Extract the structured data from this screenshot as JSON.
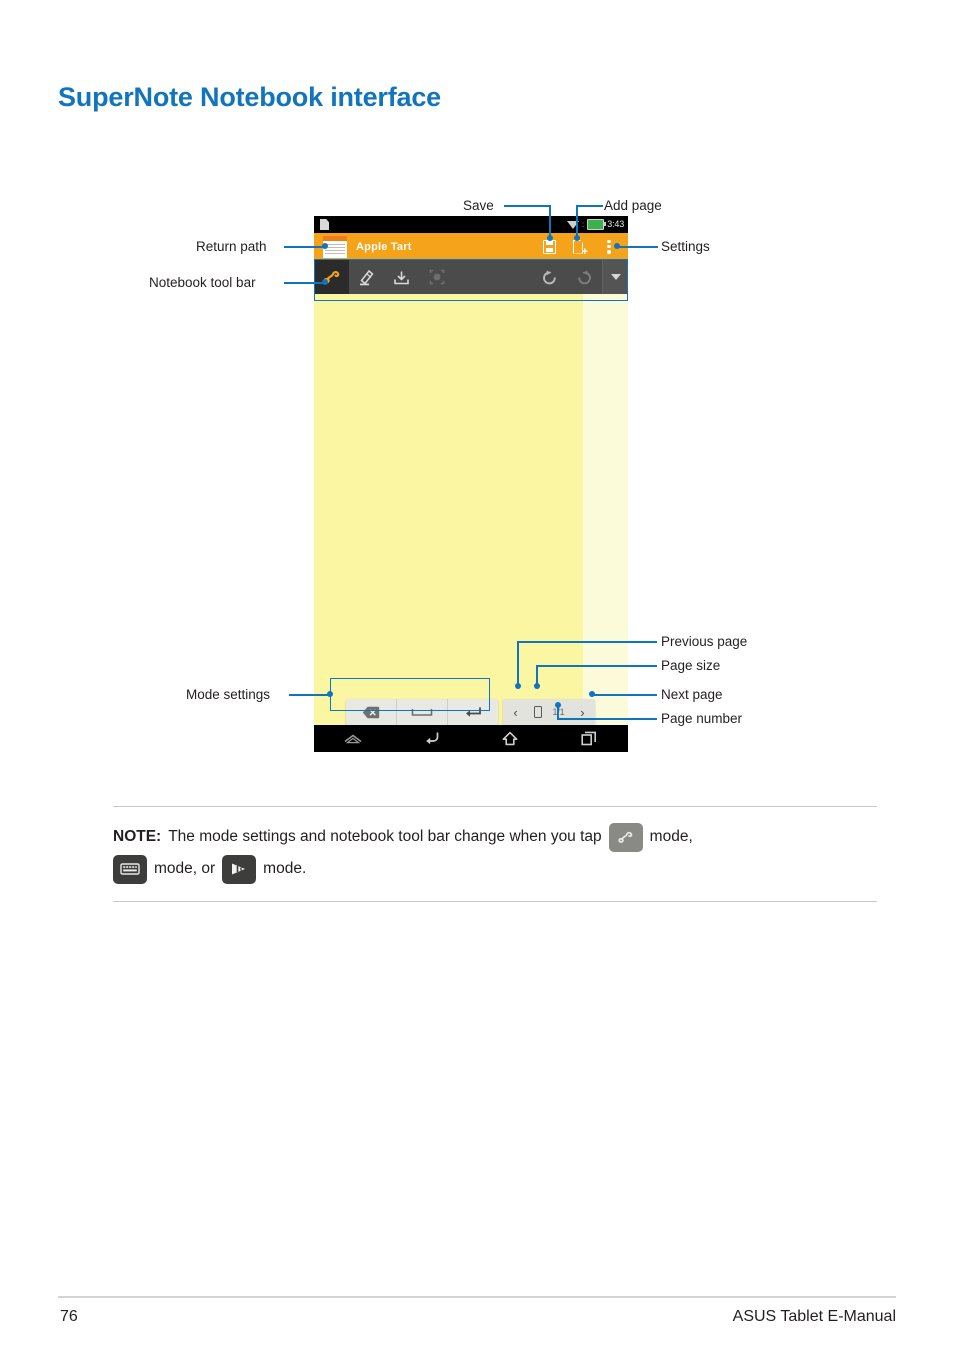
{
  "page": {
    "title": "SuperNote Notebook interface",
    "number": "76",
    "manual_title": "ASUS Tablet E-Manual"
  },
  "callouts": {
    "return_path": "Return path",
    "notebook_tool_bar": "Notebook tool bar",
    "save": "Save",
    "add_page": "Add page",
    "settings": "Settings",
    "previous_page": "Previous page",
    "page_size": "Page size",
    "next_page": "Next page",
    "page_number": "Page number",
    "mode_settings": "Mode settings",
    "line_color": "#0f75bc"
  },
  "device": {
    "statusbar": {
      "time": "3:43",
      "icons": [
        "document-icon",
        "wifi-icon",
        "battery-icon"
      ],
      "battery_color": "#3bb14a"
    },
    "titlebar": {
      "notebook_name": "Apple Tart",
      "accent_color": "#f5a31a",
      "actions": [
        "save-icon",
        "add-page-icon",
        "settings-icon"
      ]
    },
    "toolbar": {
      "background_color": "#4b4b4b",
      "tools": [
        {
          "name": "scribble-tool",
          "active": true
        },
        {
          "name": "pen-tool",
          "active": false
        },
        {
          "name": "insert-image-tool",
          "active": false
        },
        {
          "name": "selection-tool",
          "active": false
        }
      ],
      "right_tools": [
        {
          "name": "undo-tool"
        },
        {
          "name": "redo-tool"
        },
        {
          "name": "expand-toolbar-caret"
        }
      ]
    },
    "paper": {
      "page_color": "#fbf6a2",
      "margin_color": "#fcfbd9"
    },
    "mode_settings": {
      "keys": [
        "backspace-key",
        "space-key",
        "enter-key"
      ]
    },
    "page_nav": {
      "previous": "‹",
      "next": "›",
      "page_indicator": "1/1"
    },
    "navbar": {
      "buttons": [
        "hide-navbar-icon",
        "back-icon",
        "home-icon",
        "recent-apps-icon"
      ]
    }
  },
  "note": {
    "label": "NOTE:",
    "text_part1": "The mode settings and notebook tool bar change when you tap",
    "text_part2": "mode,",
    "text_part3": "mode, or",
    "text_part4": "mode.",
    "chips": [
      "scribble-mode-icon",
      "keyboard-mode-icon",
      "brush-mode-icon"
    ]
  }
}
